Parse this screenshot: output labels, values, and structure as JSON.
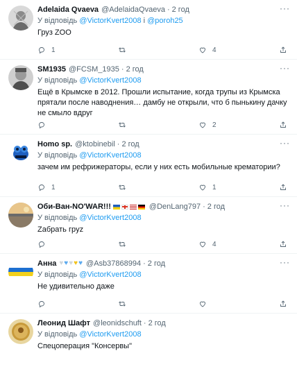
{
  "reply_prefix": "У відповідь",
  "tweets": [
    {
      "name": "Adelaida Qvaeva",
      "handle": "@AdelaidaQvaeva",
      "time": "2 год",
      "mention1": "@VictorKvert2008",
      "connector": "і",
      "mention2": "@poroh25",
      "text": "Груз ZOO",
      "replies": "1",
      "retweets": "",
      "likes": "4"
    },
    {
      "name": "SM1935",
      "handle": "@FCSM_1935",
      "time": "2 год",
      "mention1": "@VictorKvert2008",
      "text": "Ещё в Крымске в 2012. Прошли испытание, когда трупы из Крымска прятали после наводнения… дамбу не открыли, что б пынькину дачку не смыло вдруг",
      "replies": "",
      "retweets": "",
      "likes": "2"
    },
    {
      "name": "Homo sp.",
      "handle": "@ktobinebil",
      "time": "2 год",
      "mention1": "@VictorKvert2008",
      "text": "зачем им рефрижераторы, если у них есть мобильные крематории?",
      "replies": "1",
      "retweets": "",
      "likes": "1"
    },
    {
      "name": "Оби-Ван-NO'WAR!!!",
      "handle": "@DenLang797",
      "time": "2 год",
      "mention1": "@VictorKvert2008",
      "text": "Zабрать грyz",
      "replies": "",
      "retweets": "",
      "likes": "4"
    },
    {
      "name": "Анна",
      "handle": "@Asb37868994",
      "time": "2 год",
      "mention1": "@VictorKvert2008",
      "text": "Не удивительно даже",
      "replies": "",
      "retweets": "",
      "likes": ""
    },
    {
      "name": "Леонид Шафт",
      "handle": "@leonidschuft",
      "time": "2 год",
      "mention1": "@VictorKvert2008",
      "text": "Спецоперация \"Консервы\"",
      "replies": "",
      "retweets": "",
      "likes": ""
    }
  ],
  "colors": {
    "link": "#1d9bf0",
    "muted": "#536471",
    "text": "#0f1419"
  },
  "icons": [
    "more-icon",
    "reply-icon",
    "retweet-icon",
    "like-icon",
    "share-icon"
  ]
}
